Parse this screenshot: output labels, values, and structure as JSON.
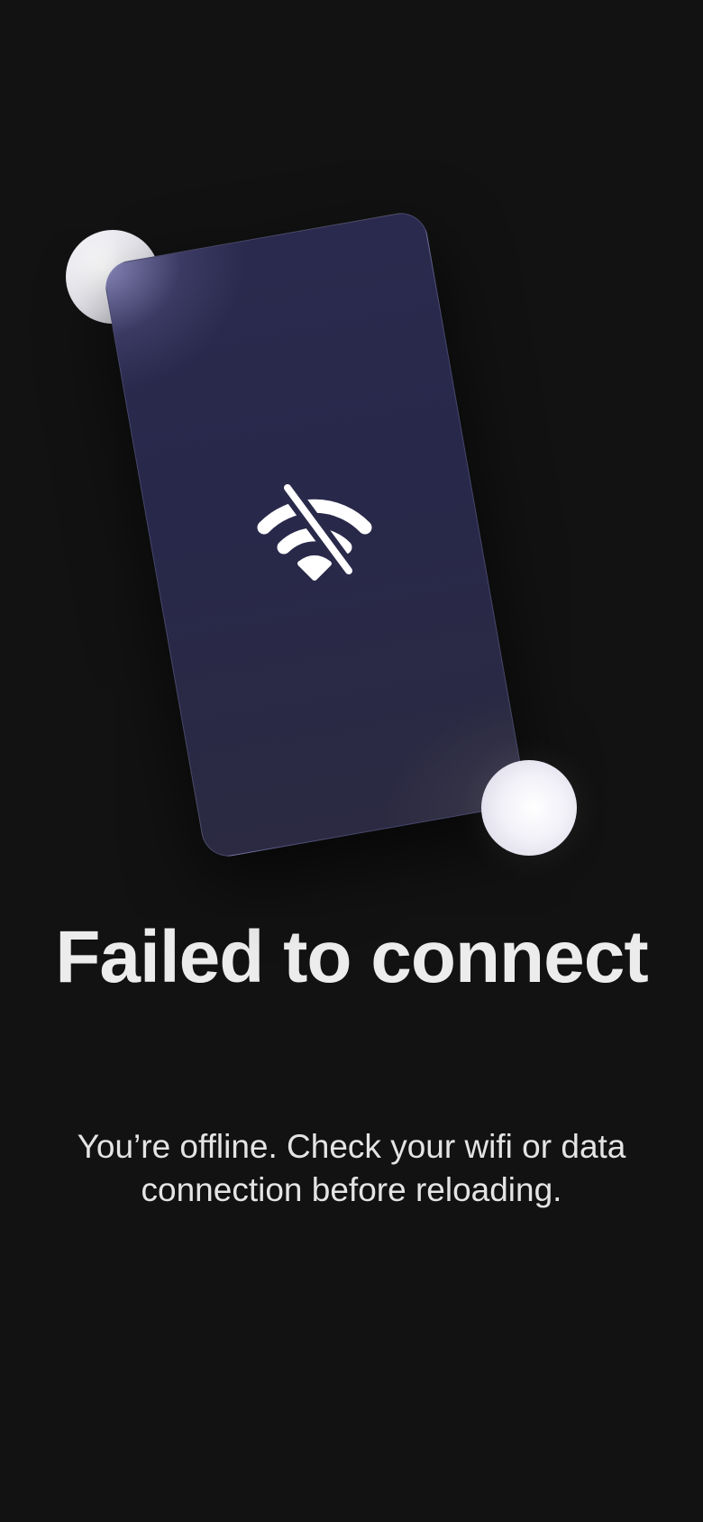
{
  "error": {
    "title": "Failed to connect",
    "message": "You’re offline. Check your wifi or data connection before reloading."
  },
  "illustration": {
    "icon": "wifi-off-icon"
  },
  "colors": {
    "background": "#121212",
    "card": "#2a2a4e",
    "text": "#ececec",
    "orb": "#f2f1f8"
  }
}
